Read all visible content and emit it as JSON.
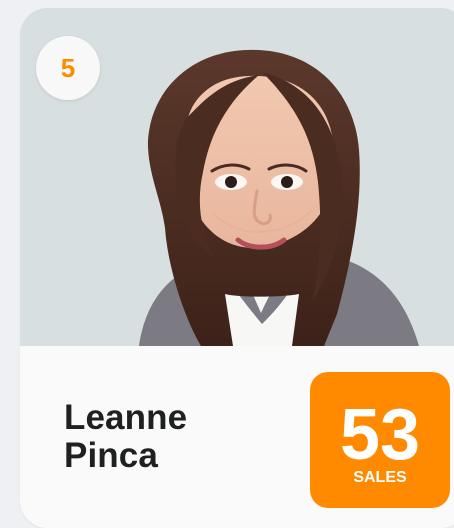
{
  "colors": {
    "accent": "#ff8a00",
    "card_background": "#fafafa",
    "name_text": "#1f2020"
  },
  "rank": "5",
  "person": {
    "first_name": "Leanne",
    "last_name": "Pinca"
  },
  "sales": {
    "count": "53",
    "label": "SALES"
  },
  "icons": {
    "portrait": "portrait-photo"
  }
}
